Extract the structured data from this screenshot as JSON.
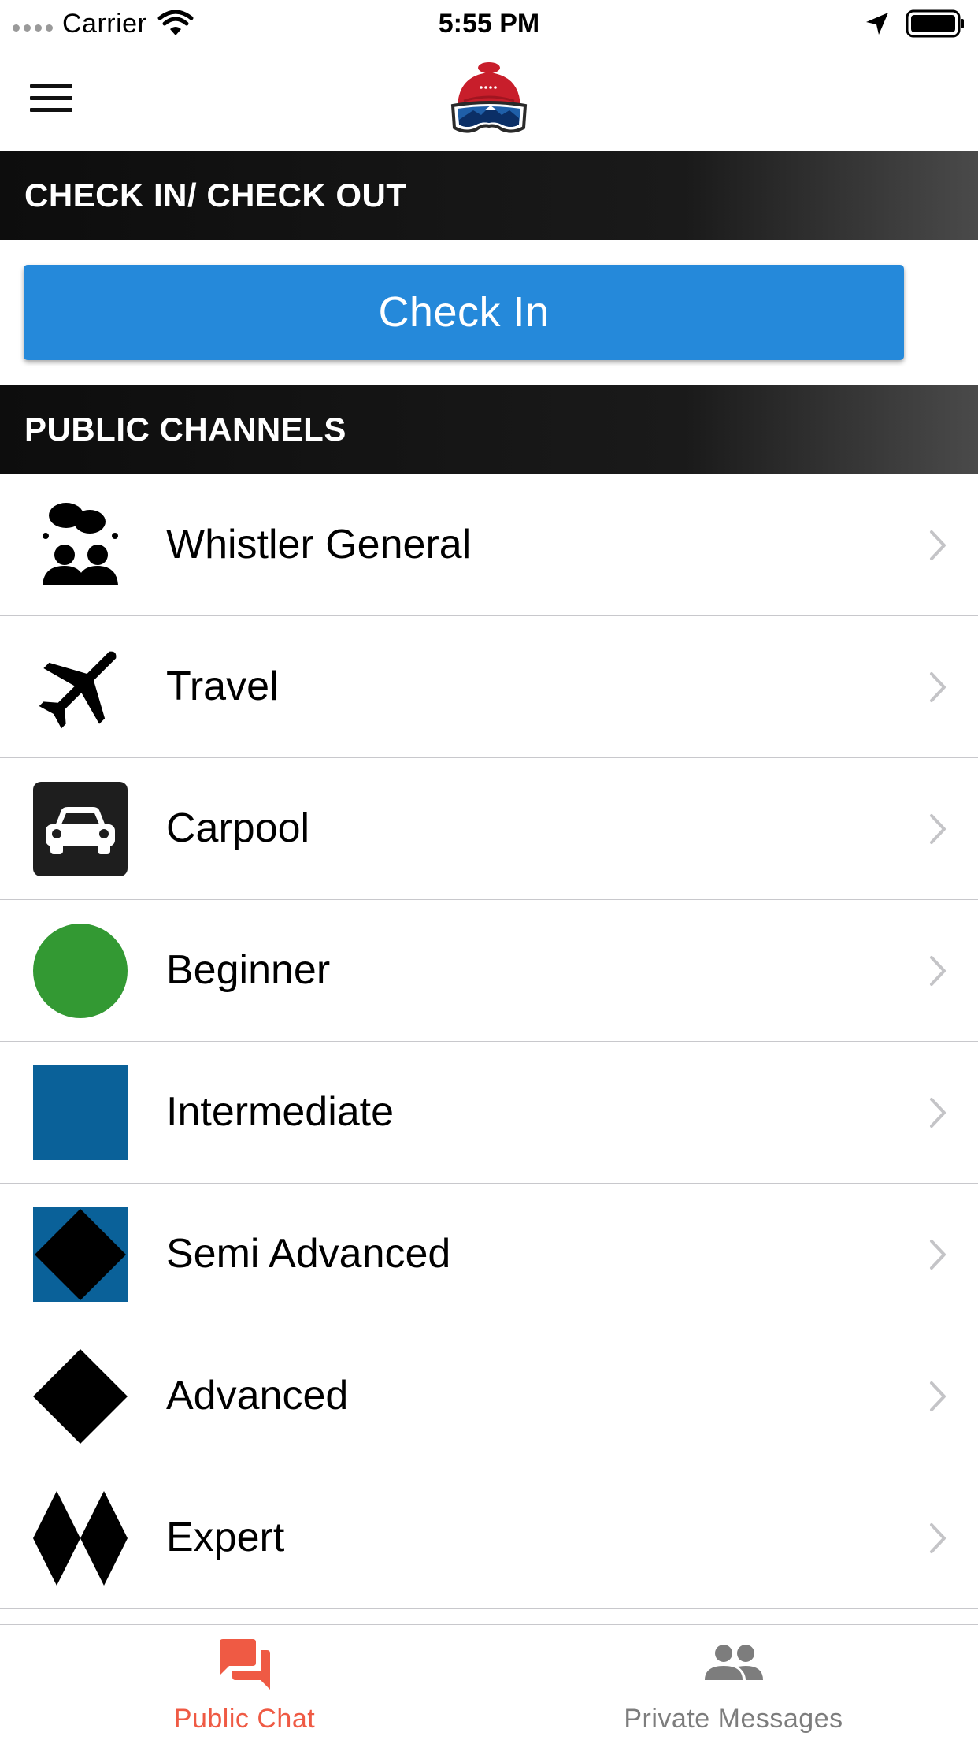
{
  "status_bar": {
    "carrier": "Carrier",
    "time": "5:55 PM",
    "icons": [
      "signal-dots-icon",
      "wifi-icon",
      "location-arrow-icon",
      "battery-icon"
    ]
  },
  "nav": {
    "menu_icon": "hamburger-menu-icon",
    "logo_icon": "beanie-goggles-logo-icon"
  },
  "checkin_section": {
    "title": "CHECK IN/ CHECK OUT",
    "button_label": "Check In"
  },
  "channels_section": {
    "title": "PUBLIC CHANNELS",
    "items": [
      {
        "label": "Whistler General",
        "icon": "group-chat-icon"
      },
      {
        "label": "Travel",
        "icon": "airplane-icon"
      },
      {
        "label": "Carpool",
        "icon": "car-icon"
      },
      {
        "label": "Beginner",
        "icon": "green-circle-icon"
      },
      {
        "label": "Intermediate",
        "icon": "blue-square-icon"
      },
      {
        "label": "Semi Advanced",
        "icon": "blue-square-black-diamond-icon"
      },
      {
        "label": "Advanced",
        "icon": "black-diamond-icon"
      },
      {
        "label": "Expert",
        "icon": "double-black-diamond-icon"
      }
    ]
  },
  "tabs": [
    {
      "label": "Public Chat",
      "icon": "chat-bubbles-icon",
      "active": true
    },
    {
      "label": "Private Messages",
      "icon": "people-icon",
      "active": false
    }
  ],
  "colors": {
    "accent_blue": "#2589da",
    "active_tab": "#ef5a44",
    "inactive_tab": "#7d7d7d",
    "beginner_green": "#339933",
    "intermediate_blue": "#0a6199"
  }
}
